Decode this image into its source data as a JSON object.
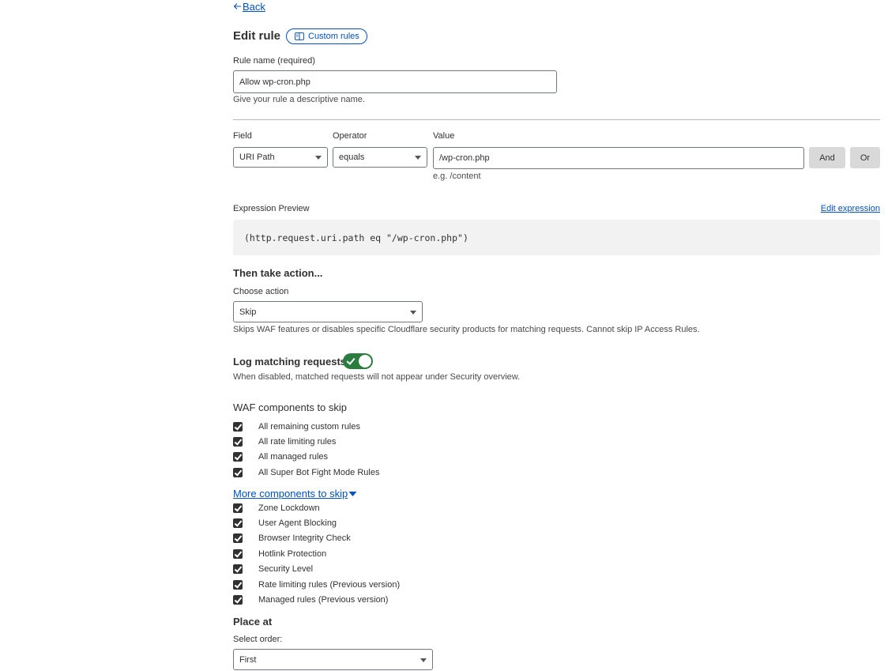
{
  "nav": {
    "back_label": "Back"
  },
  "header": {
    "title": "Edit rule",
    "docs_pill_label": "Custom rules"
  },
  "rule_name": {
    "label": "Rule name (required)",
    "value": "Allow wp-cron.php",
    "helper": "Give your rule a descriptive name."
  },
  "condition": {
    "field_label": "Field",
    "field_value": "URI Path",
    "operator_label": "Operator",
    "operator_value": "equals",
    "value_label": "Value",
    "value_value": "/wp-cron.php",
    "value_helper": "e.g. /content",
    "and_label": "And",
    "or_label": "Or"
  },
  "expression": {
    "label": "Expression Preview",
    "edit_link": "Edit expression",
    "code": "(http.request.uri.path eq \"/wp-cron.php\")"
  },
  "action": {
    "heading": "Then take action...",
    "label": "Choose action",
    "value": "Skip",
    "helper": "Skips WAF features or disables specific Cloudflare security products for matching requests. Cannot skip IP Access Rules."
  },
  "logging": {
    "label": "Log matching requests",
    "enabled": true,
    "helper": "When disabled, matched requests will not appear under Security overview."
  },
  "waf_skip": {
    "heading": "WAF components to skip",
    "items": [
      {
        "label": "All remaining custom rules",
        "checked": true
      },
      {
        "label": "All rate limiting rules",
        "checked": true
      },
      {
        "label": "All managed rules",
        "checked": true
      },
      {
        "label": "All Super Bot Fight Mode Rules",
        "checked": true
      }
    ]
  },
  "more_skip": {
    "toggle_label": "More components to skip",
    "items": [
      {
        "label": "Zone Lockdown",
        "checked": true
      },
      {
        "label": "User Agent Blocking",
        "checked": true
      },
      {
        "label": "Browser Integrity Check",
        "checked": true
      },
      {
        "label": "Hotlink Protection",
        "checked": true
      },
      {
        "label": "Security Level",
        "checked": true
      },
      {
        "label": "Rate limiting rules (Previous version)",
        "checked": true
      },
      {
        "label": "Managed rules (Previous version)",
        "checked": true
      }
    ]
  },
  "place_at": {
    "heading": "Place at",
    "label": "Select order:",
    "value": "First"
  },
  "colors": {
    "link": "#0051c3",
    "toggle_on": "#2b7d3f",
    "checkbox": "#313131"
  }
}
